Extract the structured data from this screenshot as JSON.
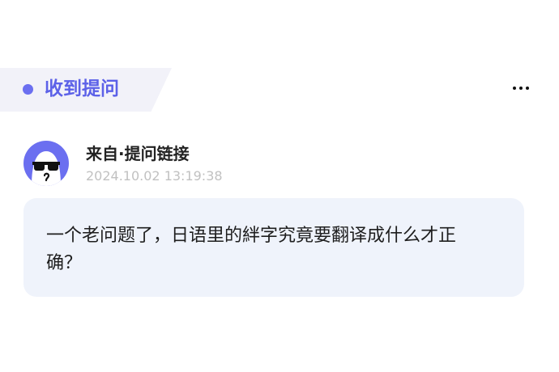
{
  "header": {
    "title": "收到提问",
    "accent_color": "#5c61e8",
    "more_icon": "more-horizontal-icon"
  },
  "sender": {
    "avatar_icon": "sunglasses-ghost-avatar",
    "avatar_color": "#6b6ff0",
    "source": "来自·提问链接",
    "timestamp": "2024.10.02 13:19:38"
  },
  "question": {
    "text": "一个老问题了，日语里的絆字究竟要翻译成什么才正确？"
  }
}
